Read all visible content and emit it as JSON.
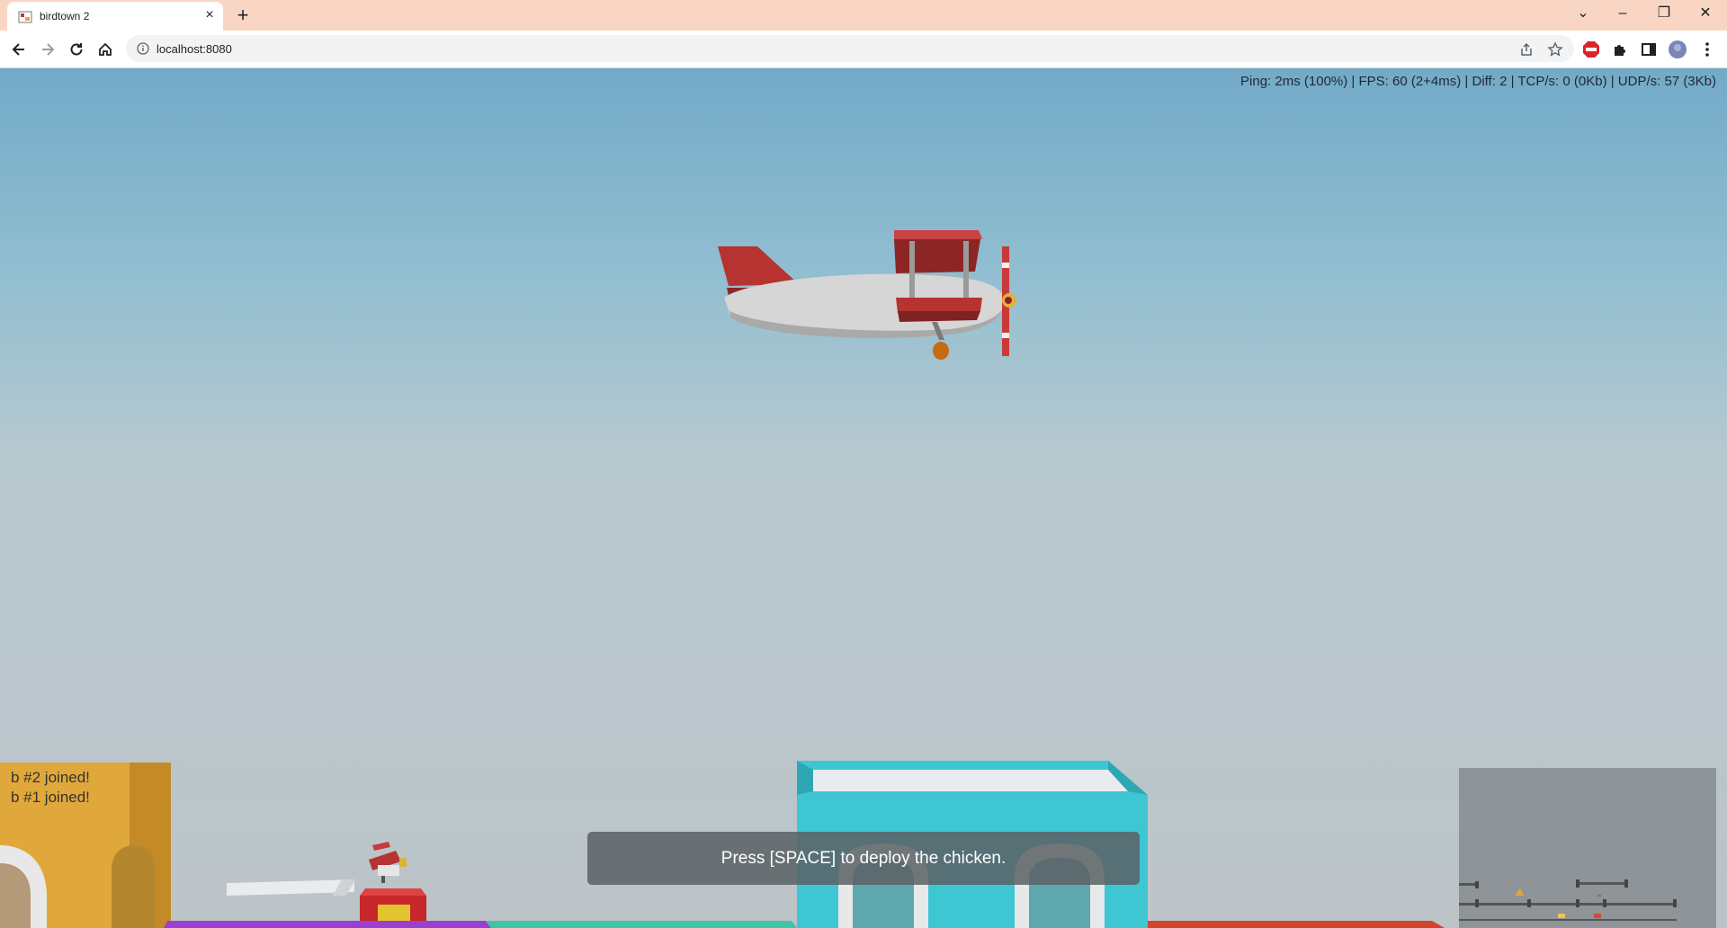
{
  "browser": {
    "tab": {
      "title": "birdtown 2",
      "close_label": "×"
    },
    "new_tab_label": "+",
    "window_controls": {
      "dropdown": "⌄",
      "minimize": "–",
      "maximize": "❐",
      "close": "✕"
    },
    "address_bar": {
      "url": "localhost:8080"
    },
    "extensions": [
      "adblock-icon",
      "puzzle-icon",
      "sidebar-icon",
      "profile-avatar",
      "kebab-menu-icon"
    ]
  },
  "game": {
    "stats": "Ping: 2ms (100%) | FPS: 60 (2+4ms) | Diff: 2 | TCP/s: 0 (0Kb) | UDP/s: 57 (3Kb)",
    "messages": [
      "b #2 joined!",
      "b #1 joined!"
    ],
    "prompt": "Press [SPACE] to deploy the chicken.",
    "colors": {
      "sky_top": "#72aac8",
      "sky_bottom": "#bcc4c8",
      "plane_red": "#b73331",
      "plane_body": "#d9d9d9",
      "building_yellow": "#e0a83a",
      "building_cyan": "#3fc6d3"
    }
  }
}
